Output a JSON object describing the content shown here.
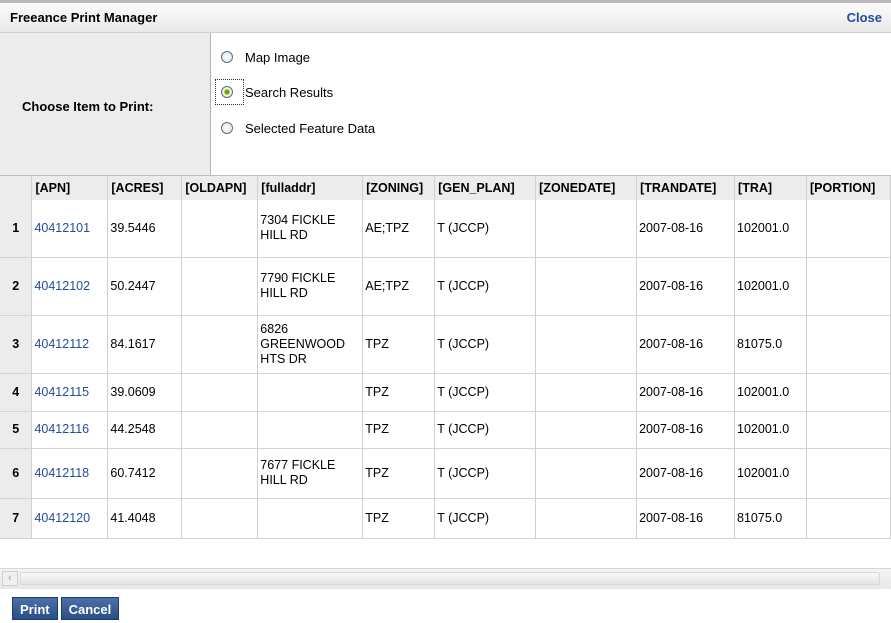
{
  "header": {
    "title": "Freeance Print Manager",
    "close_label": "Close"
  },
  "choose": {
    "label": "Choose Item to Print:",
    "options": [
      {
        "label": "Map Image",
        "checked": false
      },
      {
        "label": "Search Results",
        "checked": true
      },
      {
        "label": "Selected Feature Data",
        "checked": false
      }
    ]
  },
  "table": {
    "columns": [
      "",
      "[APN]",
      "[ACRES]",
      "[OLDAPN]",
      "[fulladdr]",
      "[ZONING]",
      "[GEN_PLAN]",
      "[ZONEDATE]",
      "[TRANDATE]",
      "[TRA]",
      "[PORTION]"
    ],
    "rows": [
      [
        "1",
        "40412101",
        "39.5446",
        "",
        "7304 FICKLE HILL RD",
        "AE;TPZ",
        "T (JCCP)",
        "",
        "2007-08-16",
        "102001.0",
        ""
      ],
      [
        "2",
        "40412102",
        "50.2447",
        "",
        "7790 FICKLE HILL RD",
        "AE;TPZ",
        "T (JCCP)",
        "",
        "2007-08-16",
        "102001.0",
        ""
      ],
      [
        "3",
        "40412112",
        "84.1617",
        "",
        "6826 GREENWOOD HTS DR",
        "TPZ",
        "T (JCCP)",
        "",
        "2007-08-16",
        "81075.0",
        ""
      ],
      [
        "4",
        "40412115",
        "39.0609",
        "",
        "",
        "TPZ",
        "T (JCCP)",
        "",
        "2007-08-16",
        "102001.0",
        ""
      ],
      [
        "5",
        "40412116",
        "44.2548",
        "",
        "",
        "TPZ",
        "T (JCCP)",
        "",
        "2007-08-16",
        "102001.0",
        ""
      ],
      [
        "6",
        "40412118",
        "60.7412",
        "",
        "7677 FICKLE HILL RD",
        "TPZ",
        "T (JCCP)",
        "",
        "2007-08-16",
        "102001.0",
        ""
      ],
      [
        "7",
        "40412120",
        "41.4048",
        "",
        "",
        "TPZ",
        "T (JCCP)",
        "",
        "2007-08-16",
        "81075.0",
        ""
      ]
    ]
  },
  "buttons": {
    "print_label": "Print",
    "cancel_label": "Cancel"
  },
  "icons": {
    "scroll_left": "chevron-left-icon"
  },
  "colors": {
    "link": "#1f4d9c",
    "button": "#2f5288",
    "header_bg": "#ececec"
  }
}
